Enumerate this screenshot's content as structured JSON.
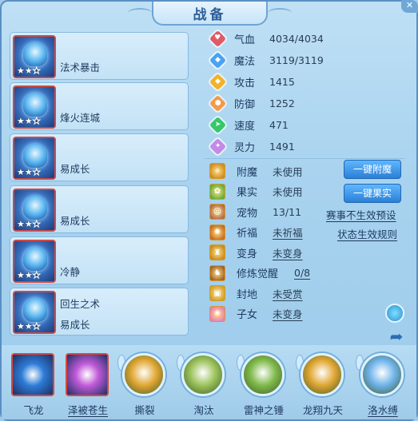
{
  "window": {
    "title": "战备"
  },
  "skills": [
    {
      "line1": "法术暴击",
      "line2": "",
      "stars": 2
    },
    {
      "line1": "烽火连城",
      "line2": "",
      "stars": 2
    },
    {
      "line1": "",
      "line2": "易成长",
      "stars": 2
    },
    {
      "line1": "",
      "line2": "易成长",
      "stars": 2
    },
    {
      "line1": "",
      "line2": "冷静",
      "stars": 2
    },
    {
      "line1": "回生之术",
      "line2": "易成长",
      "stars": 2
    }
  ],
  "stats": [
    {
      "label": "气血",
      "value": "4034/4034",
      "color": "#e05a66",
      "icon": "heart-icon"
    },
    {
      "label": "魔法",
      "value": "3119/3119",
      "color": "#4aa3f2",
      "icon": "mana-icon"
    },
    {
      "label": "攻击",
      "value": "1415",
      "color": "#f3b22c",
      "icon": "attack-icon"
    },
    {
      "label": "防御",
      "value": "1252",
      "color": "#f39a4a",
      "icon": "shield-icon"
    },
    {
      "label": "速度",
      "value": "471",
      "color": "#35c86a",
      "icon": "speed-icon"
    },
    {
      "label": "灵力",
      "value": "1491",
      "color": "#c48ae8",
      "icon": "spirit-icon"
    }
  ],
  "extras": [
    {
      "label": "附魔",
      "value": "未使用"
    },
    {
      "label": "果实",
      "value": "未使用"
    },
    {
      "label": "宠物",
      "value": "13/11"
    },
    {
      "label": "祈福",
      "value": "未祈福"
    },
    {
      "label": "变身",
      "value": "未变身"
    },
    {
      "label": "修炼觉醒",
      "value": "0/8"
    },
    {
      "label": "封地",
      "value": "未受赏"
    },
    {
      "label": "子女",
      "value": "未变身"
    }
  ],
  "buttons": {
    "enchant": "一键附魔",
    "fruit": "一键果实",
    "match_preset": "赛事不生效预设",
    "status_rules": "状态生效规则"
  },
  "bottom": [
    {
      "label": "飞龙",
      "style": "square",
      "color": "#2d7cd8"
    },
    {
      "label": "泽被苍生",
      "style": "square",
      "color": "#c05ad8"
    },
    {
      "label": "撕裂",
      "style": "round",
      "color": "#e0a632"
    },
    {
      "label": "淘汰",
      "style": "round",
      "color": "#9bc25a"
    },
    {
      "label": "雷神之锤",
      "style": "round",
      "color": "#7fb94a"
    },
    {
      "label": "龙翔九天",
      "style": "round",
      "color": "#e0a632"
    },
    {
      "label": "洛水缚",
      "style": "round",
      "color": "#6fb3ea"
    }
  ]
}
